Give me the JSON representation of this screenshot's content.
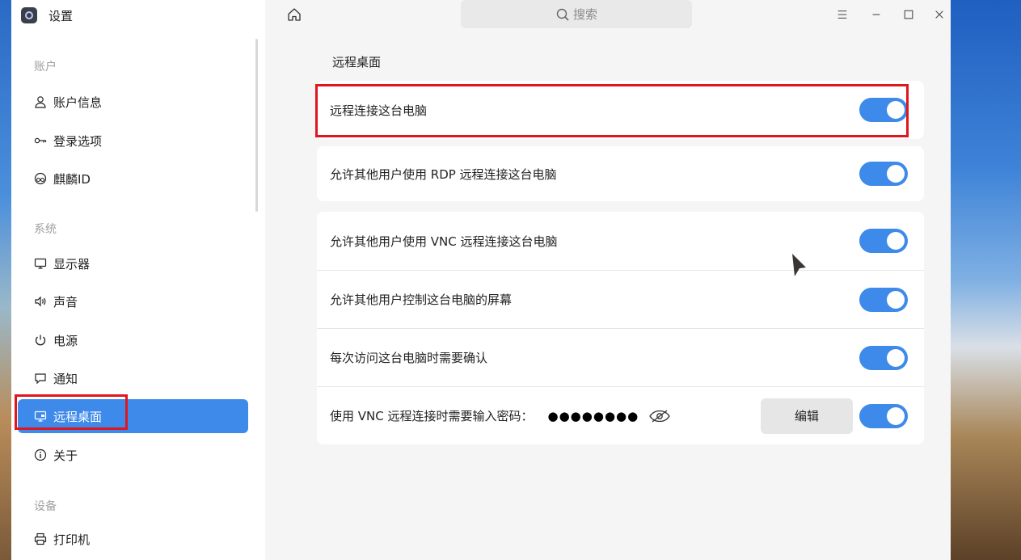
{
  "app": {
    "title": "设置"
  },
  "sidebar": {
    "groups": [
      {
        "label": "账户",
        "items": [
          {
            "label": "账户信息",
            "icon": "user-icon"
          },
          {
            "label": "登录选项",
            "icon": "key-icon"
          },
          {
            "label": "麒麟ID",
            "icon": "cloud-id-icon"
          }
        ]
      },
      {
        "label": "系统",
        "items": [
          {
            "label": "显示器",
            "icon": "monitor-icon"
          },
          {
            "label": "声音",
            "icon": "speaker-icon"
          },
          {
            "label": "电源",
            "icon": "power-icon"
          },
          {
            "label": "通知",
            "icon": "notification-icon"
          },
          {
            "label": "远程桌面",
            "icon": "remote-desktop-icon",
            "active": true
          },
          {
            "label": "关于",
            "icon": "info-icon"
          }
        ]
      },
      {
        "label": "设备",
        "items": [
          {
            "label": "打印机",
            "icon": "printer-icon"
          }
        ]
      }
    ]
  },
  "topbar": {
    "search_placeholder": "搜索"
  },
  "main": {
    "section_title": "远程桌面",
    "card1": {
      "label": "远程连接这台电脑",
      "enabled": true
    },
    "card2": {
      "label": "允许其他用户使用 RDP 远程连接这台电脑",
      "enabled": true
    },
    "card3": {
      "rows": [
        {
          "label": "允许其他用户使用 VNC 远程连接这台电脑",
          "enabled": true
        },
        {
          "label": "允许其他用户控制这台电脑的屏幕",
          "enabled": true
        },
        {
          "label": "每次访问这台电脑时需要确认",
          "enabled": true
        },
        {
          "label": "使用 VNC 远程连接时需要输入密码：",
          "password_mask": "●●●●●●●●",
          "edit_label": "编辑",
          "enabled": true
        }
      ]
    }
  },
  "colors": {
    "accent": "#3d8aeb",
    "highlight": "#e0161e"
  }
}
